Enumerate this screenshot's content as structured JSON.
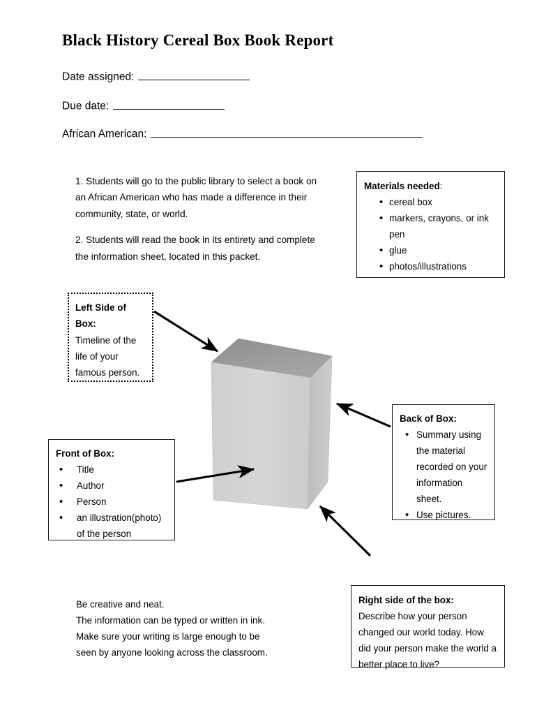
{
  "document": {
    "title": "Black History Cereal Box Book Report"
  },
  "header_fields": [
    {
      "label": "Date assigned:",
      "value": "",
      "rule_width": 160
    },
    {
      "label": "Due date:",
      "value": "",
      "rule_width": 160
    },
    {
      "label": "African American:",
      "value": "",
      "rule_width": 390
    }
  ],
  "instructions": {
    "step1": "1.  Students will go to the public library to select a book on an African American who has made a difference in their community, state, or world.",
    "step2": "2. Students will read the book in its entirety and complete the information sheet, located in this packet."
  },
  "materials": {
    "heading": "Materials needed",
    "heading_suffix": ":",
    "items": [
      "cereal box",
      "markers, crayons, or ink pen",
      "glue",
      "photos/illustrations"
    ]
  },
  "left_side": {
    "heading": "Left Side of Box:",
    "text": "Timeline of the life of your famous person."
  },
  "front": {
    "heading": "Front of Box:",
    "items": [
      "Title",
      "Author",
      "Person",
      "an illustration(photo) of the person"
    ]
  },
  "back": {
    "heading": "Back of Box:",
    "items": [
      "Summary using the material recorded on your information sheet.",
      "Use pictures."
    ]
  },
  "right_side": {
    "heading": "Right side of the box:",
    "text": "Describe how your person changed our world today. How did your person make the world a better place to live?"
  },
  "closing_note": {
    "line1": "Be creative and neat.",
    "line2": "The information can be typed or written in ink. Make sure your writing is large enough to be seen by anyone looking across the classroom."
  },
  "illustration": {
    "name": "cereal-box-3d",
    "colors": {
      "front_face": "#d2d2d2",
      "side_face": "#c6c6c6",
      "top_face": "#9a9a9a",
      "outline": "#bdbdbd",
      "arrow": "#000000"
    },
    "arrows": [
      {
        "name": "arrow-to-top-of-box",
        "from_label": "left_side",
        "to_label": "box_top"
      },
      {
        "name": "arrow-to-front-of-box",
        "from_label": "front",
        "to_label": "box_front"
      },
      {
        "name": "arrow-to-back-of-box",
        "from_label": "back",
        "to_label": "box_side"
      },
      {
        "name": "arrow-to-right-side-of-box",
        "from_label": "right_side",
        "to_label": "box_bottom_right"
      }
    ]
  }
}
